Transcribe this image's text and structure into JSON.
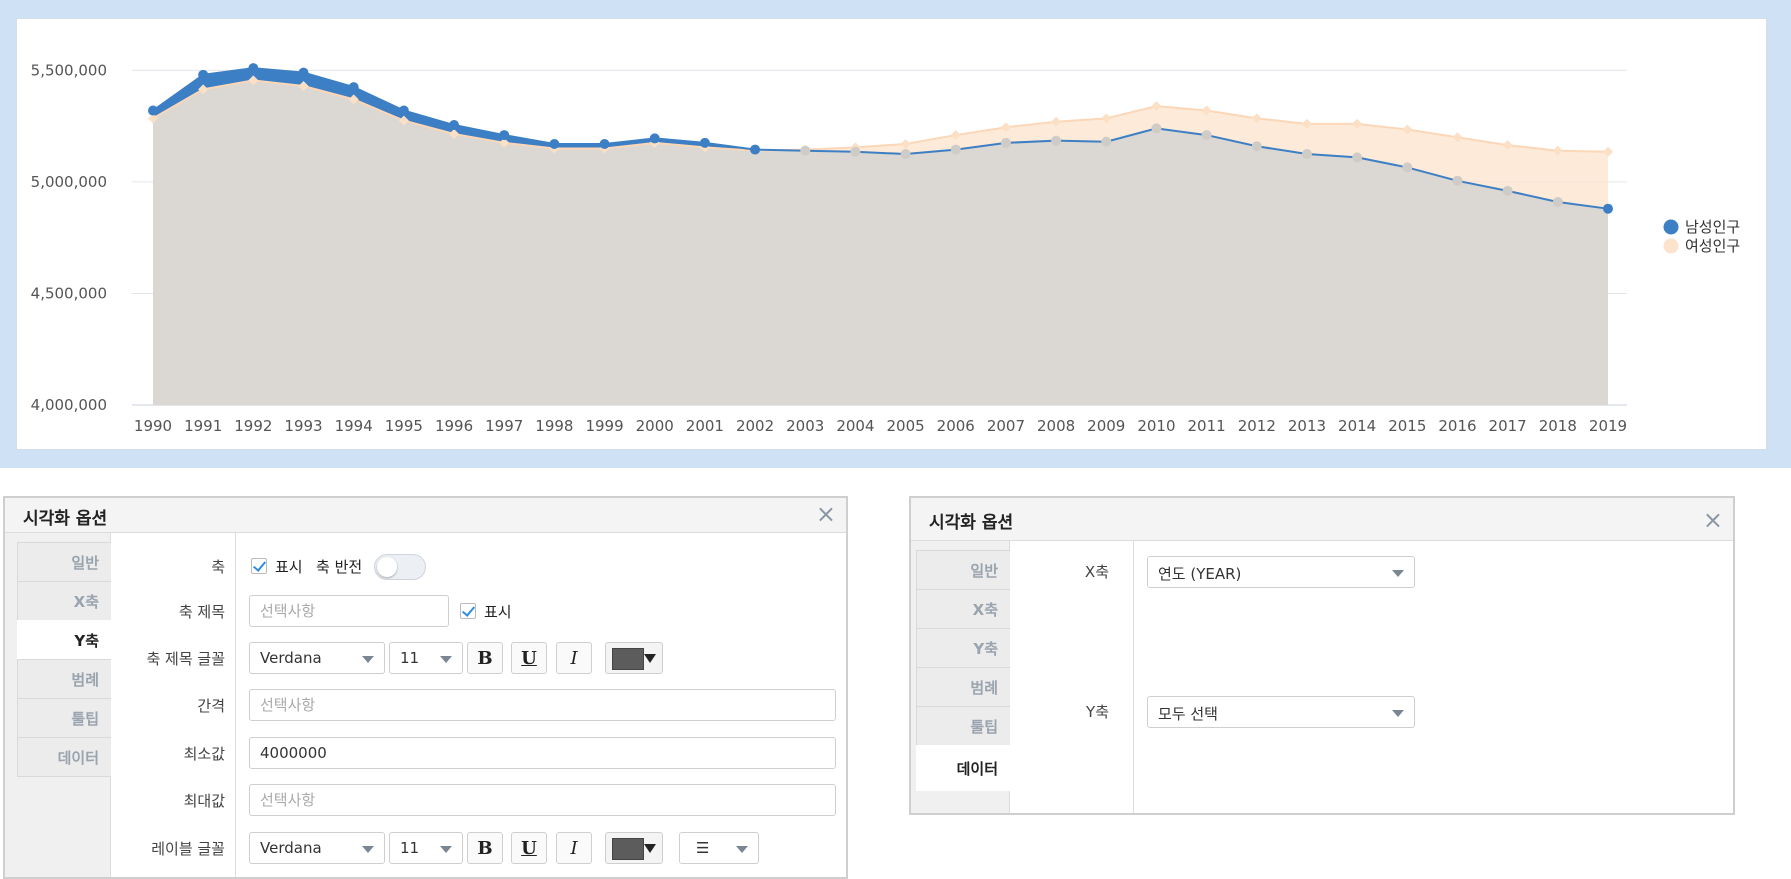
{
  "chart_data": {
    "type": "area",
    "x": [
      1990,
      1991,
      1992,
      1993,
      1994,
      1995,
      1996,
      1997,
      1998,
      1999,
      2000,
      2001,
      2002,
      2003,
      2004,
      2005,
      2006,
      2007,
      2008,
      2009,
      2010,
      2011,
      2012,
      2013,
      2014,
      2015,
      2016,
      2017,
      2018,
      2019
    ],
    "ylim": [
      4000000,
      5600000
    ],
    "yticks": [
      "5,500,000",
      "5,000,000",
      "4,500,000",
      "4,000,000"
    ],
    "ytick_values": [
      5500000,
      5000000,
      4500000,
      4000000
    ],
    "legend_position": "right",
    "series": [
      {
        "name": "남성인구",
        "color": "#3d7fc4",
        "values": [
          5320000,
          5480000,
          5510000,
          5490000,
          5425000,
          5320000,
          5255000,
          5210000,
          5170000,
          5170000,
          5195000,
          5175000,
          5145000,
          5140000,
          5135000,
          5125000,
          5145000,
          5175000,
          5185000,
          5180000,
          5240000,
          5210000,
          5160000,
          5125000,
          5110000,
          5065000,
          5005000,
          4960000,
          4910000,
          4880000
        ]
      },
      {
        "name": "여성인구",
        "color": "#fde3cc",
        "values": [
          5285000,
          5415000,
          5455000,
          5430000,
          5370000,
          5275000,
          5215000,
          5175000,
          5150000,
          5150000,
          5175000,
          5155000,
          5140000,
          5145000,
          5155000,
          5170000,
          5210000,
          5245000,
          5270000,
          5285000,
          5340000,
          5320000,
          5285000,
          5260000,
          5260000,
          5235000,
          5200000,
          5165000,
          5140000,
          5135000
        ]
      }
    ]
  },
  "panel_left": {
    "title": "시각화 옵션",
    "close": "×",
    "tabs": [
      "일반",
      "X축",
      "Y축",
      "범례",
      "툴팁",
      "데이터"
    ],
    "labels": {
      "axis": "축",
      "axis_title": "축 제목",
      "axis_title_font": "축 제목 글꼴",
      "interval": "간격",
      "min": "최소값",
      "max": "최대값",
      "label_font": "레이블 글꼴"
    },
    "show": "표시",
    "axis_reverse": "축 반전",
    "placeholder": "선택사항",
    "font_name": "Verdana",
    "font_size": "11",
    "bold": "B",
    "underline": "U",
    "italic": "I",
    "min_value": "4000000",
    "align_icon": "☰"
  },
  "panel_right": {
    "title": "시각화 옵션",
    "close": "×",
    "tabs": [
      "일반",
      "X축",
      "Y축",
      "범례",
      "툴팁",
      "데이터"
    ],
    "x_label": "X축",
    "x_value": "연도 (YEAR)",
    "y_label": "Y축",
    "y_value": "모두 선택"
  }
}
